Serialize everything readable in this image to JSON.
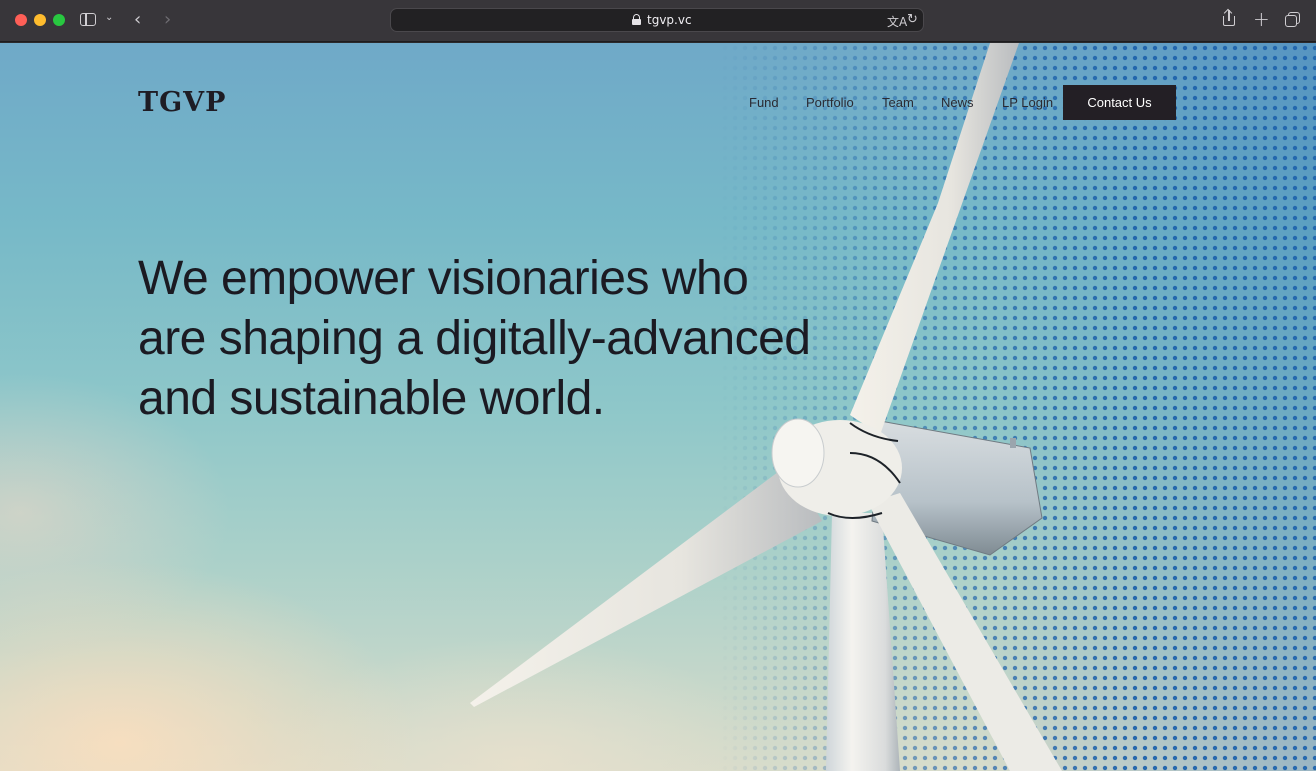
{
  "browser": {
    "url": "tgvp.vc",
    "icons": {
      "sidebar": "sidebar-icon",
      "back": "chevron-left-icon",
      "forward": "chevron-right-icon",
      "lock": "lock-icon",
      "translate": "translate-icon",
      "reload": "reload-icon",
      "share": "share-icon",
      "new_tab": "plus-icon",
      "tab_overview": "tabs-icon"
    }
  },
  "site": {
    "logo": "TGVP",
    "nav": {
      "fund": "Fund",
      "portfolio": "Portfolio",
      "team": "Team",
      "news": "News",
      "lp_login": "LP Login",
      "contact": "Contact Us"
    },
    "headline": {
      "line1": "We empower visionaries who",
      "line2": "are shaping a digitally-advanced",
      "line3": "and sustainable world."
    }
  },
  "colors": {
    "accent_dark": "#231f25",
    "halftone_blue": "#1c60aa",
    "sky": "#77b9c8"
  }
}
